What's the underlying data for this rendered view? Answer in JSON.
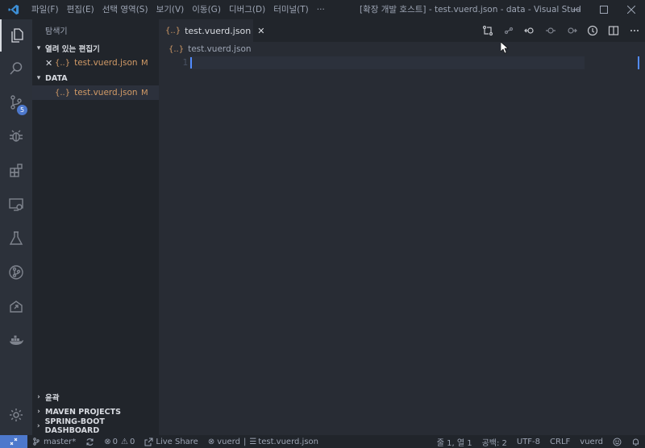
{
  "titlebar": {
    "menu": [
      "파일(F)",
      "편집(E)",
      "선택 영역(S)",
      "보기(V)",
      "이동(G)",
      "디버그(D)",
      "터미널(T)",
      "···"
    ],
    "title": "[확장 개발 호스트] - test.vuerd.json - data - Visual Stud..."
  },
  "activity_bar": {
    "items": [
      "explorer-icon",
      "search-icon",
      "source-control-icon",
      "debug-icon",
      "extensions-icon",
      "remote-explorer-icon",
      "testing-icon",
      "git-graph-icon",
      "deploy-icon",
      "docker-icon"
    ],
    "scm_badge": "5",
    "bottom": [
      "settings-gear-icon"
    ]
  },
  "sidebar": {
    "title": "탐색기",
    "open_editors_label": "열려 있는 편집기",
    "open_editor_file": "test.vuerd.json",
    "open_editor_status": "M",
    "folder_label": "DATA",
    "folder_file": "test.vuerd.json",
    "folder_file_status": "M",
    "json_glyph": "{..}",
    "bottom_sections": [
      "윤곽",
      "MAVEN PROJECTS",
      "SPRING-BOOT DASHBOARD"
    ]
  },
  "editor": {
    "tab_label": "test.vuerd.json",
    "breadcrumb": "test.vuerd.json",
    "line_number": "1"
  },
  "statusbar": {
    "branch": "master*",
    "errors": "0",
    "warnings": "0",
    "live_share": "Live Share",
    "vuerd_left": "vuerd",
    "separator": "|",
    "vuerd_file": "test.vuerd.json",
    "position": "줄 1, 열 1",
    "spaces": "공백: 2",
    "encoding": "UTF-8",
    "eol": "CRLF",
    "language": "vuerd"
  },
  "colors": {
    "accent": "#4d78cc",
    "json_file": "#d19a66",
    "background": "#282c34",
    "sidebar": "#21252b"
  }
}
